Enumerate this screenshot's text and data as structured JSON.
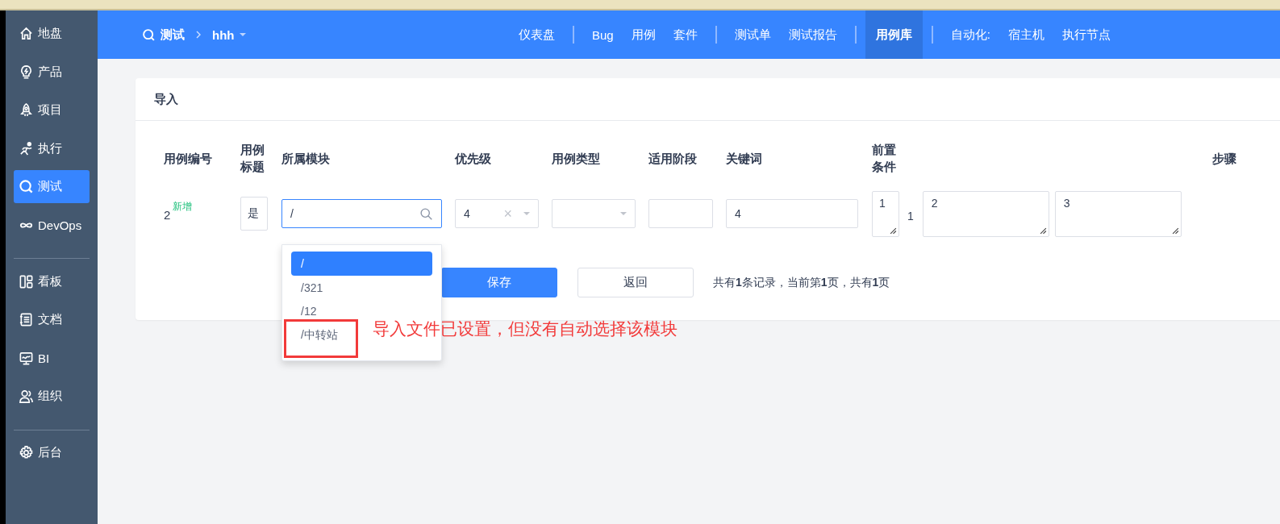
{
  "sidebar": {
    "groups": [
      [
        {
          "label": "地盘",
          "selected": false
        },
        {
          "label": "产品",
          "selected": false
        },
        {
          "label": "项目",
          "selected": false
        },
        {
          "label": "执行",
          "selected": false
        },
        {
          "label": "测试",
          "selected": true
        },
        {
          "label": "DevOps",
          "selected": false
        }
      ],
      [
        {
          "label": "看板",
          "selected": false
        },
        {
          "label": "文档",
          "selected": false
        },
        {
          "label": "BI",
          "selected": false
        },
        {
          "label": "组织",
          "selected": false
        }
      ],
      [
        {
          "label": "后台",
          "selected": false
        }
      ]
    ]
  },
  "header": {
    "breadcrumb": {
      "section": "测试",
      "product": "hhh"
    },
    "nav_groups": [
      [
        {
          "label": "仪表盘",
          "selected": false
        }
      ],
      [
        {
          "label": "Bug",
          "selected": false
        },
        {
          "label": "用例",
          "selected": false
        },
        {
          "label": "套件",
          "selected": false
        }
      ],
      [
        {
          "label": "测试单",
          "selected": false
        },
        {
          "label": "测试报告",
          "selected": false
        }
      ],
      [
        {
          "label": "用例库",
          "selected": true
        }
      ],
      [
        {
          "label": "自动化:",
          "selected": false
        },
        {
          "label": "宿主机",
          "selected": false
        },
        {
          "label": "执行节点",
          "selected": false
        }
      ]
    ]
  },
  "card": {
    "title": "导入",
    "columns": [
      {
        "label": "用例编号"
      },
      {
        "label": "用例标题"
      },
      {
        "label": "所属模块"
      },
      {
        "label": "优先级"
      },
      {
        "label": "用例类型"
      },
      {
        "label": "适用阶段"
      },
      {
        "label": "关键词"
      },
      {
        "label": "前置条件"
      },
      {
        "label": "步骤"
      }
    ],
    "row": {
      "number": "2",
      "badge": "新增",
      "title": "是",
      "module": {
        "value": "/",
        "expanded": true,
        "options": [
          {
            "label": "/",
            "selected": true
          },
          {
            "label": "/321",
            "selected": false
          },
          {
            "label": "/12",
            "selected": false
          },
          {
            "label": "/中转站",
            "selected": false,
            "highlighted": true
          }
        ]
      },
      "priority": {
        "value": "4",
        "clear_icon": "×"
      },
      "keywords": "4",
      "precondition": "1",
      "step_number": "1",
      "step": "2",
      "expected": "3"
    },
    "buttons": [
      {
        "label": "保存",
        "kind": "primary"
      },
      {
        "label": "返回",
        "kind": "default"
      }
    ],
    "pagination": "共有**1**条记录，当前第**1**页，共有**1**页"
  },
  "annotation": {
    "text": "导入文件已设置，但没有自动选择该模块"
  }
}
